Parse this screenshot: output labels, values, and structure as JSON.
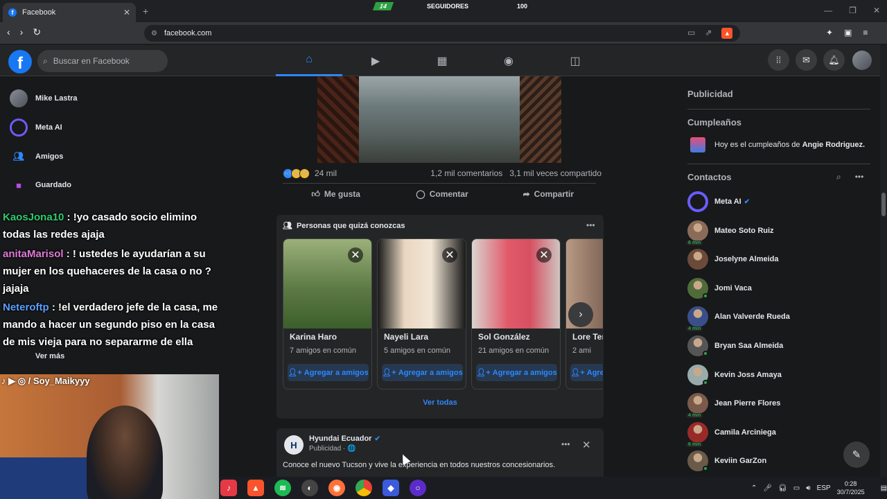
{
  "browser": {
    "tab_title": "Facebook",
    "tab_favicon": "f",
    "new_tab": "+",
    "url": "facebook.com",
    "window_controls": [
      "—",
      "❐",
      "✕"
    ]
  },
  "stream_overlay": {
    "badge": "14",
    "label": "SEGUIDORES",
    "goal": "100"
  },
  "fb": {
    "logo": "f",
    "search_placeholder": "Buscar en Facebook",
    "nav_icons": [
      "home-icon",
      "video-icon",
      "marketplace-icon",
      "groups-icon",
      "gaming-icon"
    ]
  },
  "left_sidebar": {
    "items": [
      {
        "label": "Mike Lastra",
        "icon": "avatar"
      },
      {
        "label": "Meta AI",
        "icon": "meta-ai-icon"
      },
      {
        "label": "Amigos",
        "icon": "friends-icon"
      },
      {
        "label": "Guardado",
        "icon": "bookmark-icon"
      }
    ],
    "ver_mas": "Ver más"
  },
  "chat": [
    {
      "user": "KaosJona10",
      "message": " : !yo casado socio elimino todas las redes ajaja"
    },
    {
      "user": "anitaMarisol",
      "message": " : ! ustedes le ayudarían a su mujer en los quehaceres de la casa o no ? jajaja"
    },
    {
      "user": "Neteroftp",
      "message": " : !el verdadero jefe de la casa, me mando a hacer un segundo piso en la casa de mis vieja para no separarme de ella"
    }
  ],
  "cam_label": "♪ ▶ ◎ / Soy_Maikyyy",
  "post": {
    "reaction_count": "24 mil",
    "comments": "1,2 mil comentarios",
    "shares": "3,1 mil veces compartido",
    "like": "Me gusta",
    "comment": "Comentar",
    "share": "Compartir"
  },
  "pymk": {
    "title": "Personas que quizá conozcas",
    "see_all": "Ver todas",
    "add_label": "Agregar a amigos",
    "people": [
      {
        "name": "Karina Haro",
        "mutual": "7 amigos en común",
        "color": "#4a6b3a"
      },
      {
        "name": "Nayeli Lara",
        "mutual": "5 amigos en común",
        "color": "#c9b7a2"
      },
      {
        "name": "Sol González",
        "mutual": "21 amigos en común",
        "color": "#d66a7a"
      },
      {
        "name": "Lore Ter",
        "mutual": "2 ami",
        "color": "#b38f7a"
      }
    ]
  },
  "ad": {
    "name": "Hyundai Ecuador",
    "sub": "Publicidad · 🌐",
    "text": "Conoce el nuevo Tucson y vive la experiencia en todos nuestros concesionarios."
  },
  "right_sidebar": {
    "publicidad": "Publicidad",
    "cumpleanos": "Cumpleaños",
    "birthday_text": "Hoy es el cumpleaños de ",
    "birthday_name": "Angie Rodriguez.",
    "contactos": "Contactos",
    "contacts": [
      {
        "name": "Meta AI",
        "status": "",
        "verified": true
      },
      {
        "name": "Mateo Soto Ruiz",
        "status": "6 min",
        "verified": false
      },
      {
        "name": "Joselyne Almeida",
        "status": "",
        "verified": false
      },
      {
        "name": "Jomi Vaca",
        "status": "online",
        "verified": false
      },
      {
        "name": "Alan Valverde Rueda",
        "status": "4 min",
        "verified": false
      },
      {
        "name": "Bryan Saa Almeida",
        "status": "online",
        "verified": false
      },
      {
        "name": "Kevin Joss Amaya",
        "status": "online",
        "verified": false
      },
      {
        "name": "Jean Pierre Flores",
        "status": "4 min",
        "verified": false
      },
      {
        "name": "Camila Arciniega",
        "status": "6 min",
        "verified": false
      },
      {
        "name": "Keviin GarZon",
        "status": "online",
        "verified": false
      }
    ]
  },
  "taskbar": {
    "lang": "ESP",
    "time": "0:28",
    "date": "30/7/2025"
  }
}
